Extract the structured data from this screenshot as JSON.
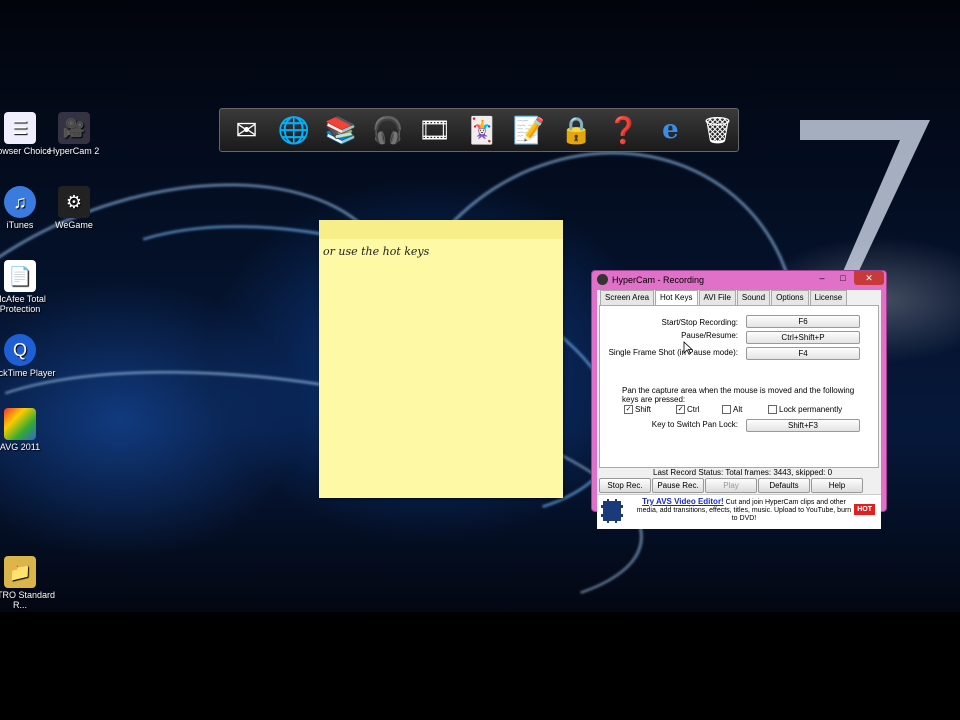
{
  "desktop_icons": [
    {
      "label": "Browser Choice"
    },
    {
      "label": "HyperCam 2"
    },
    {
      "label": "iTunes"
    },
    {
      "label": "WeGame"
    },
    {
      "label": "McAfee Total Protection"
    },
    {
      "label": "QuickTime Player"
    },
    {
      "label": "AVG 2011"
    },
    {
      "label": "LOTRO Standard R..."
    }
  ],
  "dock_icons": [
    "mail-icon",
    "globe-icon",
    "books-icon",
    "headphones-icon",
    "film-reel-icon",
    "cards-dice-icon",
    "notepad-icon",
    "padlock-icon",
    "help-icon",
    "internet-explorer-icon",
    "recycle-bin-icon"
  ],
  "sticky_note": {
    "text": "or use the hot keys"
  },
  "hypercam": {
    "title": "HyperCam - Recording",
    "tabs": [
      "Screen Area",
      "Hot Keys",
      "AVI File",
      "Sound",
      "Options",
      "License"
    ],
    "active_tab": "Hot Keys",
    "start_stop_label": "Start/Stop Recording:",
    "start_stop_value": "F6",
    "pause_label": "Pause/Resume:",
    "pause_value": "Ctrl+Shift+P",
    "single_frame_label": "Single Frame Shot (in Pause mode):",
    "single_frame_value": "F4",
    "pan_text": "Pan the capture area when the mouse is moved and the following keys are pressed:",
    "shift_label": "Shift",
    "ctrl_label": "Ctrl",
    "alt_label": "Alt",
    "lock_label": "Lock permanently",
    "pan_lock_label": "Key to Switch Pan Lock:",
    "pan_lock_value": "Shift+F3",
    "status": "Last Record Status: Total frames: 3443, skipped: 0",
    "buttons": {
      "stop": "Stop Rec.",
      "pause": "Pause Rec.",
      "play": "Play",
      "defaults": "Defaults",
      "help": "Help"
    },
    "ad": {
      "link": "Try AVS Video Editor!",
      "text": " Cut and join HyperCam clips and other media, add transitions, effects, titles, music. Upload to YouTube, burn to DVD!",
      "badge": "HOT"
    }
  },
  "colors": {
    "window_frame": "#e070c8",
    "sticky": "#fdf9a4"
  }
}
